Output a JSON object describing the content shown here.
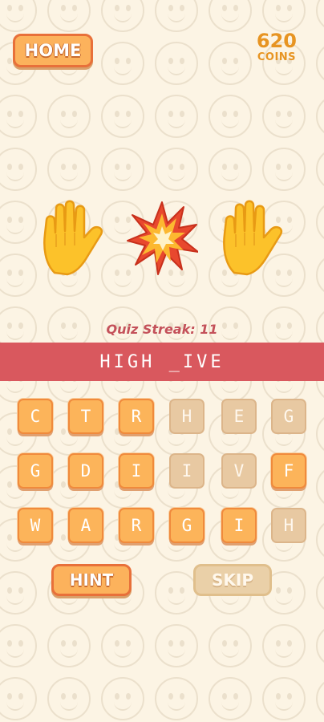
{
  "header": {
    "home_label": "HOME",
    "coins_value": "620",
    "coins_label": "COINS"
  },
  "clue": {
    "emojis": [
      "raised-hand-icon",
      "collision-icon",
      "raised-hand-icon"
    ]
  },
  "quiz": {
    "streak_text": "Quiz Streak: 11",
    "answer_text": "HIGH _IVE"
  },
  "tiles": [
    {
      "letter": "C",
      "state": "active"
    },
    {
      "letter": "T",
      "state": "active"
    },
    {
      "letter": "R",
      "state": "active"
    },
    {
      "letter": "H",
      "state": "used"
    },
    {
      "letter": "E",
      "state": "used"
    },
    {
      "letter": "G",
      "state": "used"
    },
    {
      "letter": "G",
      "state": "active"
    },
    {
      "letter": "D",
      "state": "active"
    },
    {
      "letter": "I",
      "state": "active"
    },
    {
      "letter": "I",
      "state": "used"
    },
    {
      "letter": "V",
      "state": "used"
    },
    {
      "letter": "F",
      "state": "active"
    },
    {
      "letter": "W",
      "state": "active"
    },
    {
      "letter": "A",
      "state": "active"
    },
    {
      "letter": "R",
      "state": "active"
    },
    {
      "letter": "G",
      "state": "active"
    },
    {
      "letter": "I",
      "state": "active"
    },
    {
      "letter": "H",
      "state": "used"
    }
  ],
  "actions": {
    "hint_label": "HINT",
    "skip_label": "SKIP"
  },
  "colors": {
    "background": "#fcf4e4",
    "button_orange": "#fcb25c",
    "button_border": "#e8703a",
    "coins": "#e79422",
    "answer_bar": "#d9585e",
    "streak": "#c4515a"
  }
}
